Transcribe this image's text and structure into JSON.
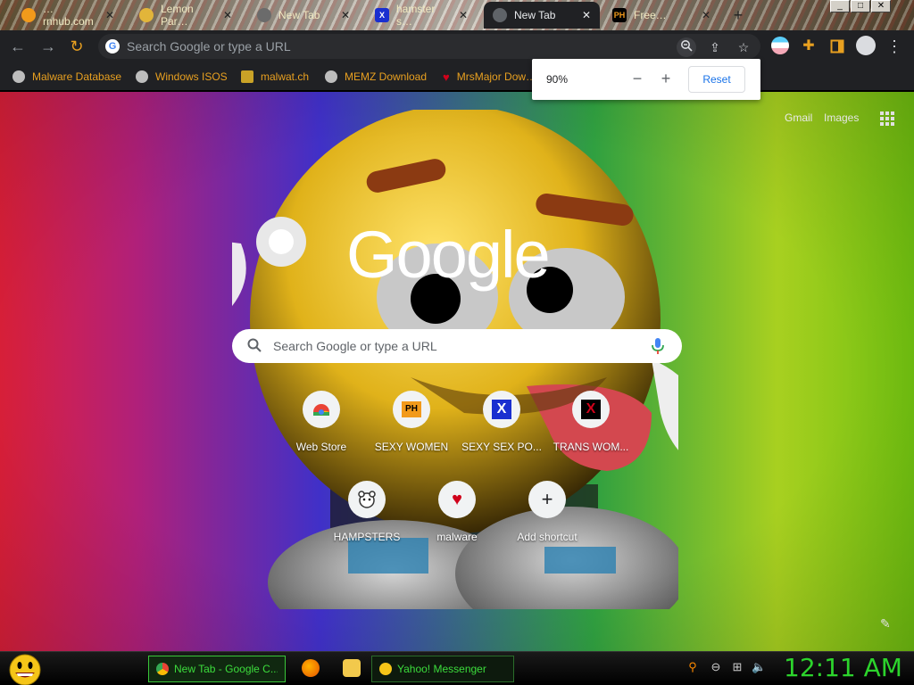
{
  "tabs": [
    {
      "title": "…rnhub.com",
      "fav_color": "#f29a1b"
    },
    {
      "title": "Lemon Par…",
      "fav_color": "#e2b53a"
    },
    {
      "title": "New Tab",
      "fav_color": "#6b6b6b"
    },
    {
      "title": "hamster s…",
      "fav_color": "#1a2fd0"
    },
    {
      "title": "New Tab",
      "fav_color": "#5f6368",
      "active": true
    },
    {
      "title": "Free…",
      "fav_color": "#f29a1b"
    }
  ],
  "omnibox": {
    "placeholder": "Search Google or type a URL"
  },
  "bookmarks": [
    {
      "label": "Malware Database"
    },
    {
      "label": "Windows ISOS"
    },
    {
      "label": "malwat.ch"
    },
    {
      "label": "MEMZ Download"
    },
    {
      "label": "MrsMajor Dow…"
    }
  ],
  "zoom_popup": {
    "percent": "90%",
    "minus": "−",
    "plus": "+",
    "reset_label": "Reset"
  },
  "ntp": {
    "gmail": "Gmail",
    "images": "Images",
    "logo": "Google",
    "search_placeholder": "Search Google or type a URL",
    "shortcuts": [
      {
        "label": "Web Store"
      },
      {
        "label": "SEXY WOMEN",
        "icon_text": "PH"
      },
      {
        "label": "SEXY SEX PO...",
        "icon_text": "X"
      },
      {
        "label": "TRANS WOM...",
        "icon_text": "X"
      },
      {
        "label": "HAMPSTERS"
      },
      {
        "label": "malware"
      },
      {
        "label": "Add shortcut",
        "icon_text": "+"
      }
    ]
  },
  "taskbar": {
    "tasks": [
      {
        "label": "New Tab - Google C...",
        "active": true
      },
      {
        "label": "Yahoo! Messenger",
        "active": false
      }
    ],
    "clock": "12:11 AM"
  },
  "colors": {
    "accent": "#1a73e8",
    "taskbar_green": "#2cd42c",
    "bookmark_orange": "#e8a020"
  }
}
